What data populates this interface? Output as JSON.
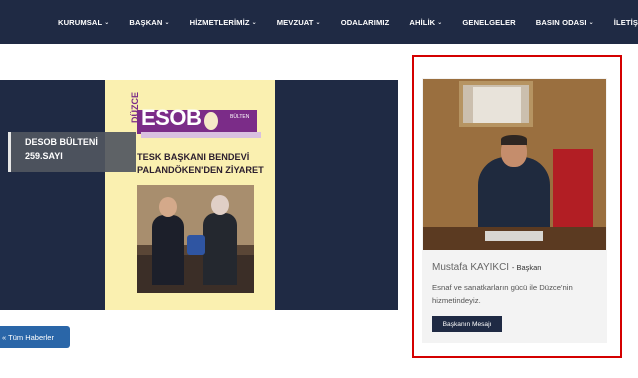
{
  "nav": {
    "items": [
      {
        "label": "KURUMSAL",
        "dropdown": true
      },
      {
        "label": "BAŞKAN",
        "dropdown": true
      },
      {
        "label": "HİZMETLERİMİZ",
        "dropdown": true
      },
      {
        "label": "MEVZUAT",
        "dropdown": true
      },
      {
        "label": "ODALARIMIZ",
        "dropdown": false
      },
      {
        "label": "AHİLİK",
        "dropdown": true
      },
      {
        "label": "GENELGELER",
        "dropdown": false
      },
      {
        "label": "BASIN ODASI",
        "dropdown": true
      },
      {
        "label": "İLETİŞİM",
        "dropdown": false
      }
    ],
    "chevron_glyph": "⌄",
    "chevron_icon": "chevron-down-icon"
  },
  "slider": {
    "caption_line1": "DESOB BÜLTENİ",
    "caption_line2": "259.SAYI",
    "cover": {
      "brand": "ESOB",
      "side_text": "DÜZCE",
      "small_text": "BÜLTEN",
      "headline_line1": "TESK BAŞKANI BENDEVİ",
      "headline_line2": "PALANDÖKEN'DEN ZİYARET"
    },
    "all_news_label": "« Tüm Haberler"
  },
  "president": {
    "name": "Mustafa KAYIKCI",
    "role": "- Başkan",
    "text": "Esnaf ve sanatkarların gücü ile Düzce'nin hizmetindeyiz.",
    "button_label": "Başkanın Mesajı"
  },
  "colors": {
    "nav_bg": "#1f2a44",
    "highlight_border": "#d40000",
    "button_blue": "#2a66a8"
  }
}
